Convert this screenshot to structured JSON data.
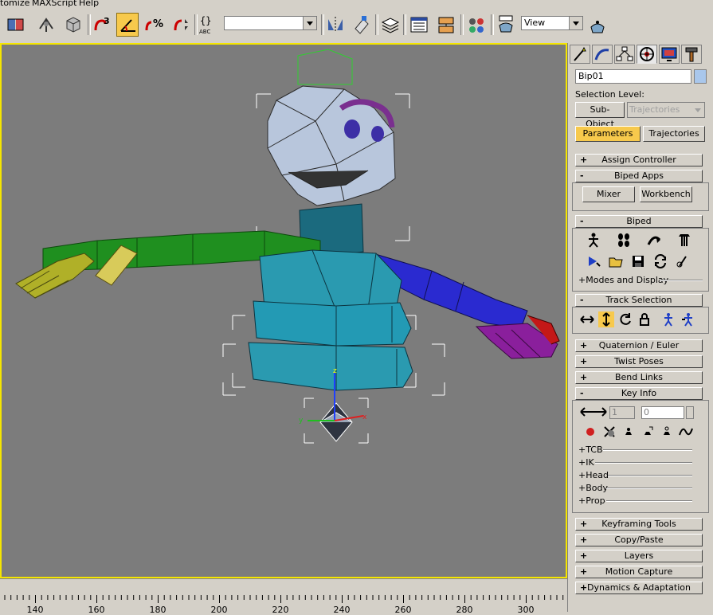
{
  "menu": {
    "customize": "tomize",
    "maxscript": "MAXScript",
    "help": "Help"
  },
  "toolbar": {
    "selection_set_value": "",
    "view_dropdown": "View",
    "abc_label": "ABC"
  },
  "command_panel": {
    "object_name": "Bip01",
    "selection_level_label": "Selection Level:",
    "sub_object_button": "Sub-Object",
    "trajectories_dropdown": "Trajectories",
    "tab_parameters": "Parameters",
    "tab_trajectories": "Trajectories",
    "rollouts": {
      "assign_controller": {
        "sign": "+",
        "label": "Assign Controller"
      },
      "biped_apps": {
        "sign": "-",
        "label": "Biped Apps"
      },
      "biped": {
        "sign": "-",
        "label": "Biped"
      },
      "track_selection": {
        "sign": "-",
        "label": "Track Selection"
      },
      "quaternion_euler": {
        "sign": "+",
        "label": "Quaternion / Euler"
      },
      "twist_poses": {
        "sign": "+",
        "label": "Twist Poses"
      },
      "bend_links": {
        "sign": "+",
        "label": "Bend Links"
      },
      "key_info": {
        "sign": "-",
        "label": "Key Info"
      },
      "keyframing_tools": {
        "sign": "+",
        "label": "Keyframing Tools"
      },
      "copy_paste": {
        "sign": "+",
        "label": "Copy/Paste"
      },
      "layers": {
        "sign": "+",
        "label": "Layers"
      },
      "motion_capture": {
        "sign": "+",
        "label": "Motion Capture"
      },
      "dynamics_adaptation": {
        "sign": "+",
        "label": "Dynamics & Adaptation"
      }
    },
    "biped_apps_buttons": {
      "mixer": "Mixer",
      "workbench": "Workbench"
    },
    "modes_and_display": "+Modes and Display",
    "key_info": {
      "key_number": "1",
      "time_value": "0",
      "subrollouts": [
        "+TCB",
        "+IK",
        "+Head",
        "+Body",
        "+Prop"
      ]
    }
  },
  "viewport": {
    "axis_x": "x",
    "axis_y": "y",
    "axis_z": "z"
  },
  "timeline": {
    "ticks": [
      "140",
      "160",
      "180",
      "200",
      "220",
      "240",
      "260",
      "280",
      "300"
    ]
  }
}
